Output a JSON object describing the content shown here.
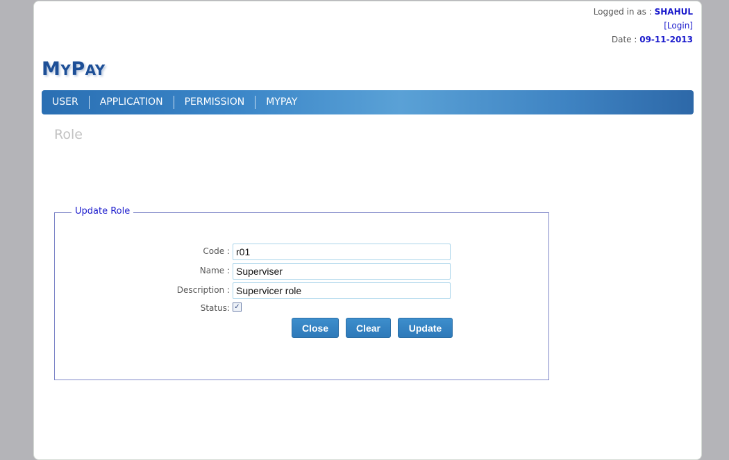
{
  "header": {
    "logged_in_label": "Logged in as : ",
    "user_name": "SHAHUL",
    "login_link": "[Login]",
    "date_label": "Date : ",
    "date_value": "09-11-2013"
  },
  "logo": {
    "first_big": "M",
    "first_small": "Y",
    "second_big": "P",
    "second_small": "AY"
  },
  "nav": {
    "items": [
      {
        "label": "USER"
      },
      {
        "label": "APPLICATION"
      },
      {
        "label": "PERMISSION"
      },
      {
        "label": "MYPAY"
      }
    ]
  },
  "page": {
    "title": "Role"
  },
  "form": {
    "legend": "Update Role",
    "code_label": "Code :",
    "code_value": "r01",
    "name_label": "Name :",
    "name_value": "Superviser",
    "description_label": "Description :",
    "description_value": "Supervicer role",
    "status_label": "Status:",
    "status_checked": true,
    "status_mark": "✓"
  },
  "buttons": {
    "close": "Close",
    "clear": "Clear",
    "update": "Update"
  }
}
